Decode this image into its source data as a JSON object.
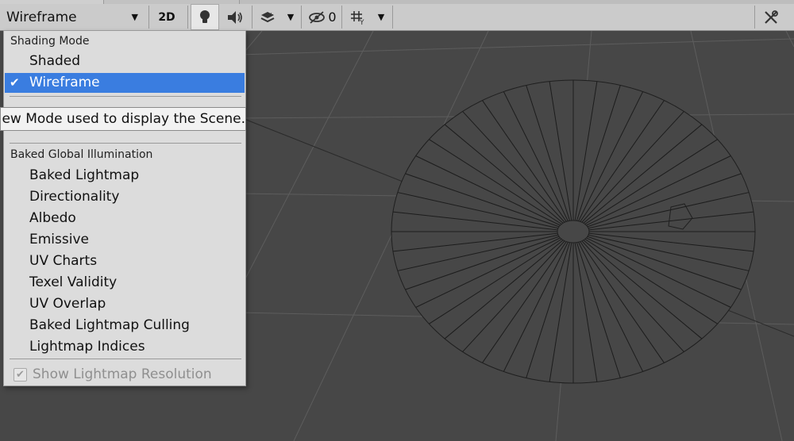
{
  "toolbar": {
    "draw_mode": "Wireframe",
    "btn_2d": "2D",
    "hidden_count": "0"
  },
  "menu": {
    "shading_header": "Shading Mode",
    "shading_items": [
      "Shaded",
      "Wireframe"
    ],
    "selected_item": "Wireframe",
    "baked_header": "Baked Global Illumination",
    "baked_items": [
      "Baked Lightmap",
      "Directionality",
      "Albedo",
      "Emissive",
      "UV Charts",
      "Texel Validity",
      "UV Overlap",
      "Baked Lightmap Culling",
      "Lightmap Indices"
    ],
    "show_resolution_label": "Show Lightmap Resolution"
  },
  "tooltip": {
    "text": "View Mode used to display the Scene."
  },
  "colors": {
    "selection": "#3a7de0",
    "viewport_bg": "#474747",
    "grid": "#5c5c5c"
  }
}
